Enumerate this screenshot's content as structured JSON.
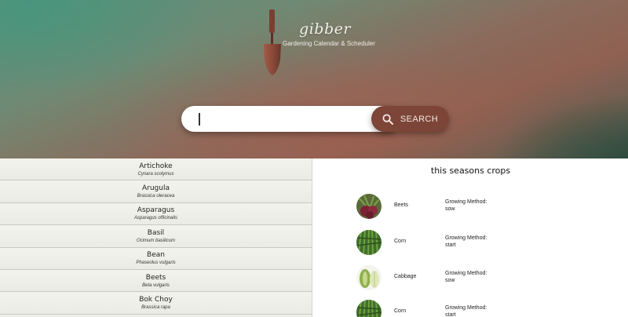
{
  "brand": {
    "name": "gibber",
    "tagline": "Gardening Calendar & Scheduler"
  },
  "search": {
    "placeholder": "",
    "value": "",
    "button_label": "SEARCH"
  },
  "plants": [
    {
      "name": "Artichoke",
      "scientific": "Cynara scolymus"
    },
    {
      "name": "Arugula",
      "scientific": "Brassica oleracea"
    },
    {
      "name": "Asparagus",
      "scientific": "Asparagus officinalis"
    },
    {
      "name": "Basil",
      "scientific": "Ocimum basilicum"
    },
    {
      "name": "Bean",
      "scientific": "Phaseolus vulgaris"
    },
    {
      "name": "Beets",
      "scientific": "Beta vulgaris"
    },
    {
      "name": "Bok Choy",
      "scientific": "Brassica rapa"
    }
  ],
  "crops": {
    "title": "this seasons crops",
    "items": [
      {
        "name": "Beets",
        "method_label": "Growing Method:",
        "method": "sow",
        "image": "beets-photo"
      },
      {
        "name": "Corn",
        "method_label": "Growing Method:",
        "method": "start",
        "image": "corn-photo"
      },
      {
        "name": "Cabbage",
        "method_label": "Growing Method:",
        "method": "sow",
        "image": "cabbage-photo"
      },
      {
        "name": "Corn",
        "method_label": "Growing Method:",
        "method": "start",
        "image": "corn-photo"
      }
    ]
  },
  "colors": {
    "search_button": "#7c4537",
    "trowel": "#8a4a3a"
  }
}
